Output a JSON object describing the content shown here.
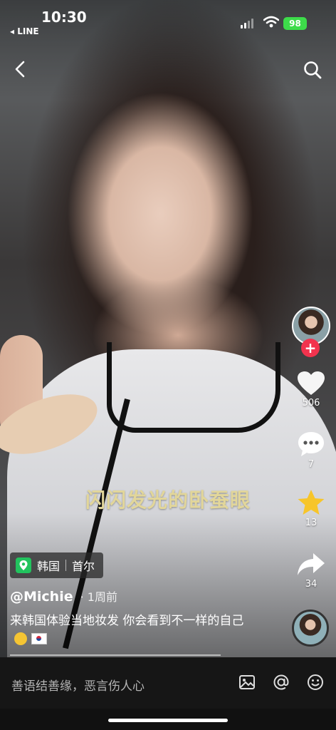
{
  "status_bar": {
    "time": "10:30",
    "back_app": "◂ LINE",
    "battery": "98"
  },
  "video": {
    "subtitle": "闪闪发光的卧蚕眼"
  },
  "side_rail": {
    "likes": "506",
    "comments": "7",
    "favorites": "13",
    "shares": "34",
    "accent_color": "#f2334e",
    "favorite_color": "#f7c52a"
  },
  "post": {
    "location_country": "韩国",
    "location_city": "首尔",
    "author": "@Michie",
    "posted_ago": "· 1周前",
    "caption": "来韩国体验当地妆发 你会看到不一样的自己"
  },
  "comment_bar": {
    "placeholder": "善语结善缘，恶言伤人心"
  }
}
